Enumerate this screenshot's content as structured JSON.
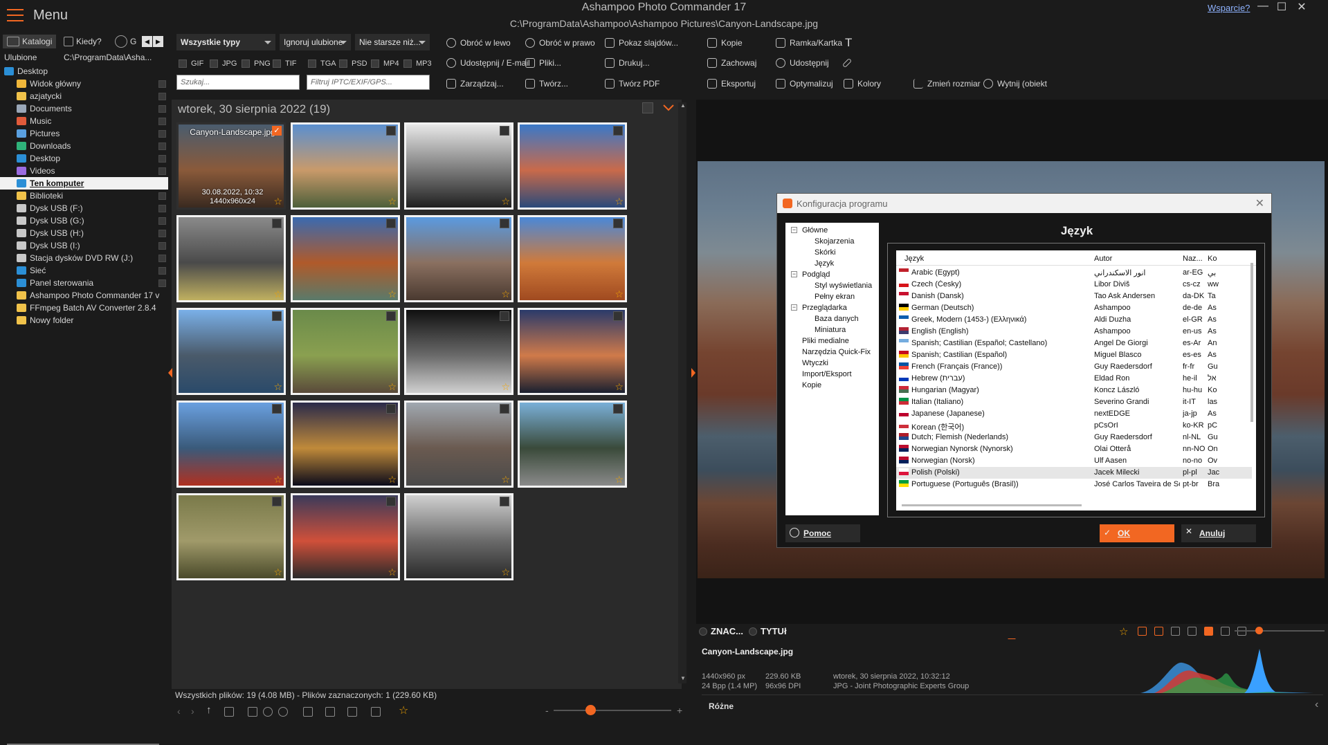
{
  "app": {
    "menu_label": "Menu",
    "title": "Ashampoo Photo Commander 17",
    "path": "C:\\ProgramData\\Ashampoo\\Ashampoo Pictures\\Canyon-Landscape.jpg",
    "support_link": "Wsparcie?"
  },
  "left": {
    "tabs": [
      "Katalogi",
      "Kiedy?",
      "G"
    ],
    "favorites_label": "Ulubione",
    "favorites_path": "C:\\ProgramData\\Asha...",
    "tree": [
      {
        "label": "Desktop",
        "color": "#2b8fd6"
      },
      {
        "label": "Widok główny",
        "color": "#f0b73a"
      },
      {
        "label": "azjatycki",
        "color": "#f0c24a"
      },
      {
        "label": "Documents",
        "color": "#9aa7b8"
      },
      {
        "label": "Music",
        "color": "#e05a3a"
      },
      {
        "label": "Pictures",
        "color": "#5aa0e0"
      },
      {
        "label": "Downloads",
        "color": "#2fb37a"
      },
      {
        "label": "Desktop",
        "color": "#2b8fd6"
      },
      {
        "label": "Videos",
        "color": "#9b6be0"
      },
      {
        "label": "Ten komputer",
        "color": "#2b8fd6"
      },
      {
        "label": "Biblioteki",
        "color": "#f0c24a"
      },
      {
        "label": "Dysk USB (F:)",
        "color": "#c8c8c8"
      },
      {
        "label": "Dysk USB (G:)",
        "color": "#c8c8c8"
      },
      {
        "label": "Dysk USB (H:)",
        "color": "#c8c8c8"
      },
      {
        "label": "Dysk USB (I:)",
        "color": "#c8c8c8"
      },
      {
        "label": "Stacja dysków DVD RW (J:)",
        "color": "#c8c8c8"
      },
      {
        "label": "Sieć",
        "color": "#2b8fd6"
      },
      {
        "label": "Panel sterowania",
        "color": "#2b8fd6"
      },
      {
        "label": "Ashampoo Photo Commander 17 v",
        "color": "#f0c24a"
      },
      {
        "label": "FFmpeg Batch AV Converter 2.8.4",
        "color": "#f0c24a"
      },
      {
        "label": "Nowy folder",
        "color": "#f0c24a"
      }
    ]
  },
  "toolbar": {
    "type_filter": "Wszystkie typy",
    "fav_filter": "Ignoruj ulubione",
    "date_filter": "Nie starsze niż...",
    "filetypes": [
      "GIF",
      "JPG",
      "PNG",
      "TIF",
      "TGA",
      "PSD",
      "MP4",
      "MP3"
    ],
    "search_placeholder": "Szukaj...",
    "iptc_placeholder": "Filtruj IPTC/EXIF/GPS...",
    "buttons": {
      "rotate_left": "Obróć w lewo",
      "rotate_right": "Obróć w prawo",
      "slideshow": "Pokaz slajdów...",
      "copies": "Kopie",
      "frame": "Ramka/Kartka",
      "share_email": "Udostępnij / E-mail",
      "files": "Pliki...",
      "print": "Drukuj...",
      "save": "Zachowaj",
      "share": "Udostępnij",
      "manage": "Zarządzaj...",
      "create": "Twórz...",
      "create_pdf": "Twórz PDF",
      "export": "Eksportuj",
      "optimize": "Optymalizuj",
      "colors": "Kolory",
      "resize": "Zmień rozmiar",
      "cut_object": "Wytnij (obiekt"
    }
  },
  "gallery": {
    "date_header": "wtorek, 30 sierpnia 2022 (19)",
    "selected": {
      "filename": "Canyon-Landscape.jpg",
      "date": "30.08.2022, 10:32",
      "dims": "1440x960x24"
    },
    "thumbs": [
      {
        "c1": "#4a5c6e",
        "c2": "#8a5a3a",
        "c3": "#3a2a20"
      },
      {
        "c1": "#5a8fd0",
        "c2": "#c99a6a",
        "c3": "#4d5f3a"
      },
      {
        "c1": "#e8e8e8",
        "c2": "#7a7a7a",
        "c3": "#202020"
      },
      {
        "c1": "#3a78c8",
        "c2": "#c96a4a",
        "c3": "#2a4a7a"
      },
      {
        "c1": "#8a8a8a",
        "c2": "#4a4a4a",
        "c3": "#c0b060"
      },
      {
        "c1": "#3a6ab0",
        "c2": "#b05a2a",
        "c3": "#5a7a6a"
      },
      {
        "c1": "#5a9ae0",
        "c2": "#8a7060",
        "c3": "#4a3a30"
      },
      {
        "c1": "#4a88d8",
        "c2": "#d07a3a",
        "c3": "#a04a20"
      },
      {
        "c1": "#7ab0e8",
        "c2": "#4a5a6a",
        "c3": "#2a4a6a"
      },
      {
        "c1": "#6a8a4a",
        "c2": "#8aa050",
        "c3": "#5a4a3a"
      },
      {
        "c1": "#101010",
        "c2": "#6a6a6a",
        "c3": "#d0d0d0"
      },
      {
        "c1": "#2a3a6a",
        "c2": "#d07a4a",
        "c3": "#1a2030"
      },
      {
        "c1": "#6aa0e0",
        "c2": "#3a5a7a",
        "c3": "#b03020"
      },
      {
        "c1": "#2a2a4a",
        "c2": "#c08a3a",
        "c3": "#0a0a1a"
      },
      {
        "c1": "#a0a8b0",
        "c2": "#6a5a50",
        "c3": "#4a4a4a"
      },
      {
        "c1": "#7ab0d8",
        "c2": "#3a4a3a",
        "c3": "#8a8a8a"
      },
      {
        "c1": "#7a7a4a",
        "c2": "#a09a6a",
        "c3": "#4a4a2a"
      },
      {
        "c1": "#3a3a5a",
        "c2": "#d0503a",
        "c3": "#2a2a2a"
      },
      {
        "c1": "#d0d0d0",
        "c2": "#6a6a6a",
        "c3": "#2a2a2a"
      }
    ],
    "status": "Wszystkich plików: 19 (4.08 MB) - Plików zaznaczonych: 1 (229.60 KB)"
  },
  "dialog": {
    "title": "Konfiguracja programu",
    "heading": "Język",
    "tree": [
      {
        "label": "Główne",
        "level": 0,
        "exp": "−"
      },
      {
        "label": "Skojarzenia",
        "level": 1
      },
      {
        "label": "Skórki",
        "level": 1
      },
      {
        "label": "Język",
        "level": 1
      },
      {
        "label": "Podgląd",
        "level": 0,
        "exp": "−"
      },
      {
        "label": "Styl wyświetlania",
        "level": 1
      },
      {
        "label": "Pełny ekran",
        "level": 1
      },
      {
        "label": "Przeglądarka",
        "level": 0,
        "exp": "−"
      },
      {
        "label": "Baza danych",
        "level": 1
      },
      {
        "label": "Miniatura",
        "level": 1
      },
      {
        "label": "Pliki medialne",
        "level": 0
      },
      {
        "label": "Narzędzia Quick-Fix",
        "level": 0
      },
      {
        "label": "Wtyczki",
        "level": 0
      },
      {
        "label": "Import/Eksport",
        "level": 0
      },
      {
        "label": "Kopie",
        "level": 0
      }
    ],
    "columns": [
      "Język",
      "Autor",
      "Naz...",
      "Ko"
    ],
    "languages": [
      {
        "lang": "Arabic (Egypt)",
        "author": "انور الاسكندراني",
        "code": "ar-EG",
        "ko": "بي",
        "f1": "#c0202a",
        "f2": "#ffffff"
      },
      {
        "lang": "Czech (Česky)",
        "author": "Libor Diviš",
        "code": "cs-cz",
        "ko": "ww",
        "f1": "#ffffff",
        "f2": "#d7141a"
      },
      {
        "lang": "Danish (Dansk)",
        "author": "Tao Ask Andersen",
        "code": "da-DK",
        "ko": "Ta",
        "f1": "#c8102e",
        "f2": "#ffffff"
      },
      {
        "lang": "German (Deutsch)",
        "author": "Ashampoo",
        "code": "de-de",
        "ko": "As",
        "f1": "#000000",
        "f2": "#ffce00"
      },
      {
        "lang": "Greek, Modern (1453-) (Ελληνικά)",
        "author": "Aldi Duzha",
        "code": "el-GR",
        "ko": "As",
        "f1": "#0d5eaf",
        "f2": "#ffffff"
      },
      {
        "lang": "English (English)",
        "author": "Ashampoo",
        "code": "en-us",
        "ko": "As",
        "f1": "#b22234",
        "f2": "#3c3b6e"
      },
      {
        "lang": "Spanish; Castilian (Español; Castellano)",
        "author": "Angel De Giorgi",
        "code": "es-Ar",
        "ko": "An",
        "f1": "#74acdf",
        "f2": "#ffffff"
      },
      {
        "lang": "Spanish; Castilian (Español)",
        "author": "Miguel Blasco",
        "code": "es-es",
        "ko": "As",
        "f1": "#c60b1e",
        "f2": "#ffc400"
      },
      {
        "lang": "French (Français (France))",
        "author": "Guy Raedersdorf",
        "code": "fr-fr",
        "ko": "Gu",
        "f1": "#0055a4",
        "f2": "#ef4135"
      },
      {
        "lang": "Hebrew (עברית)",
        "author": "Eldad Ron",
        "code": "he-il",
        "ko": "אל",
        "f1": "#ffffff",
        "f2": "#0038b8"
      },
      {
        "lang": "Hungarian (Magyar)",
        "author": "Koncz László",
        "code": "hu-hu",
        "ko": "Ko",
        "f1": "#ce2939",
        "f2": "#477050"
      },
      {
        "lang": "Italian (Italiano)",
        "author": "Severino Grandi",
        "code": "it-IT",
        "ko": "las",
        "f1": "#009246",
        "f2": "#ce2b37"
      },
      {
        "lang": "Japanese (Japanese)",
        "author": "nextEDGE",
        "code": "ja-jp",
        "ko": "As",
        "f1": "#ffffff",
        "f2": "#bc002d"
      },
      {
        "lang": "Korean (한국어)",
        "author": "pCsOrI",
        "code": "ko-KR",
        "ko": "pC",
        "f1": "#ffffff",
        "f2": "#cd2e3a"
      },
      {
        "lang": "Dutch; Flemish (Nederlands)",
        "author": "Guy Raedersdorf",
        "code": "nl-NL",
        "ko": "Gu",
        "f1": "#ae1c28",
        "f2": "#21468b"
      },
      {
        "lang": "Norwegian Nynorsk (Nynorsk)",
        "author": "Olai Otterå",
        "code": "nn-NO",
        "ko": "On",
        "f1": "#ba0c2f",
        "f2": "#00205b"
      },
      {
        "lang": "Norwegian (Norsk)",
        "author": "Ulf Aasen",
        "code": "no-no",
        "ko": "Ov",
        "f1": "#ba0c2f",
        "f2": "#00205b"
      },
      {
        "lang": "Polish (Polski)",
        "author": "Jacek Milecki",
        "code": "pl-pl",
        "ko": "Jac",
        "f1": "#ffffff",
        "f2": "#dc143c",
        "selected": true
      },
      {
        "lang": "Portuguese (Português (Brasil))",
        "author": "José Carlos Taveira de Souza",
        "code": "pt-br",
        "ko": "Bra",
        "f1": "#009c3b",
        "f2": "#ffdf00"
      }
    ],
    "help_btn": "Pomoc",
    "ok_btn": "OK",
    "cancel_btn": "Anuluj"
  },
  "info": {
    "tab1": "ZNAC...",
    "tab2": "TYTUł",
    "filename": "Canyon-Landscape.jpg",
    "dims": "1440x960 px",
    "bpp": "24 Bpp (1.4 MP)",
    "size": "229.60 KB",
    "dpi": "96x96 DPI",
    "datetime": "wtorek, 30 sierpnia 2022, 10:32:12",
    "format": "JPG - Joint Photographic Experts Group",
    "roznes": "Różne"
  },
  "colors": {
    "accent": "#f26722",
    "bg": "#1b1b1b",
    "panel": "#2a2a2a"
  }
}
